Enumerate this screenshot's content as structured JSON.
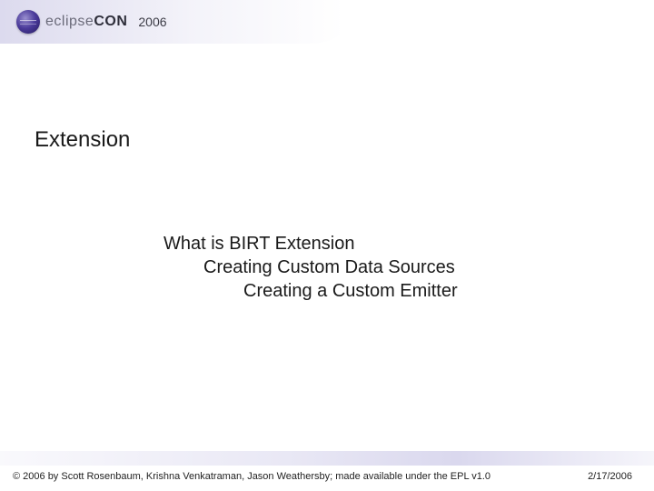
{
  "header": {
    "logo_light": "eclipse",
    "logo_bold": "CON",
    "year": "2006"
  },
  "slide": {
    "title": "Extension",
    "lines": {
      "l1": "What is BIRT Extension",
      "l2": "Creating Custom Data Sources",
      "l3": "Creating a Custom Emitter"
    }
  },
  "footer": {
    "copyright": "© 2006 by Scott Rosenbaum, Krishna Venkatraman, Jason Weathersby; made available under the EPL v1.0",
    "date": "2/17/2006"
  }
}
